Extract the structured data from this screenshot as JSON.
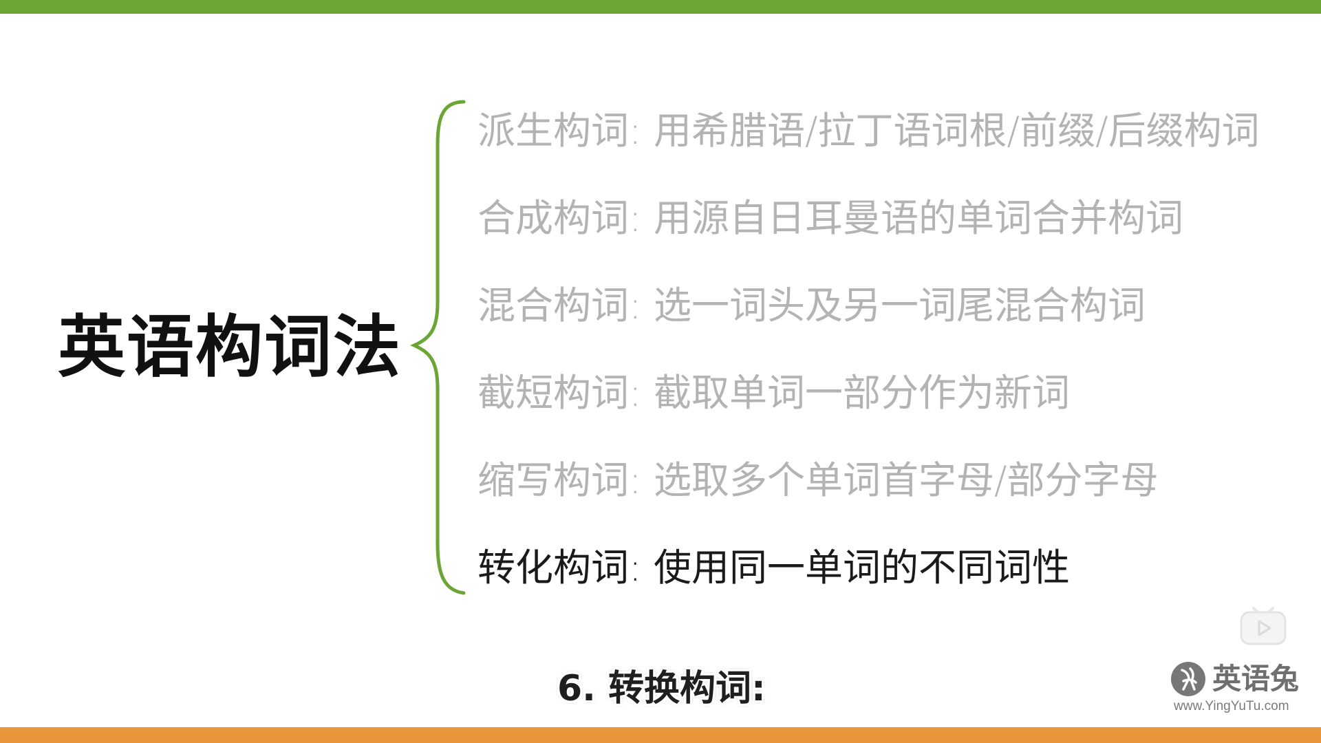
{
  "colors": {
    "top_bar": "#6aa535",
    "bottom_bar": "#e8963a",
    "brace": "#6aa535",
    "inactive_text": "#b3b3b3",
    "active_text": "#1a1a1a"
  },
  "slide": {
    "title": "英语构词法",
    "items": [
      {
        "term": "派生构词",
        "separator": ": ",
        "description": "用希腊语/拉丁语词根/前缀/后缀构词",
        "active": false
      },
      {
        "term": "合成构词",
        "separator": ": ",
        "description": "用源自日耳曼语的单词合并构词",
        "active": false
      },
      {
        "term": "混合构词",
        "separator": ": ",
        "description": "选一词头及另一词尾混合构词",
        "active": false
      },
      {
        "term": "截短构词",
        "separator": ": ",
        "description": "截取单词一部分作为新词",
        "active": false
      },
      {
        "term": "缩写构词",
        "separator": ": ",
        "description": "选取多个单词首字母/部分字母",
        "active": false
      },
      {
        "term": "转化构词",
        "separator": ": ",
        "description": "使用同一单词的不同词性",
        "active": true
      }
    ]
  },
  "subtitle": "6. 转换构词:",
  "watermark": {
    "brand": "英语兔",
    "url": "www.YingYuTu.com",
    "logo_icon": "rabbit-logo-icon"
  },
  "overlay": {
    "icon": "play-icon"
  }
}
